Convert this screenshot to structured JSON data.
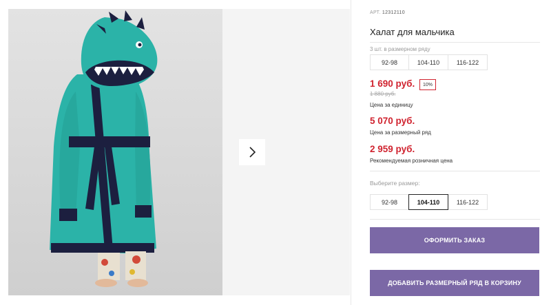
{
  "product": {
    "article_label": "АРТ.",
    "article_value": "12312110",
    "title": "Халат для мальчика",
    "pack_info": "3 шт. в размерном ряду",
    "pack_sizes": [
      "92-98",
      "104-110",
      "116-122"
    ]
  },
  "pricing": {
    "unit_price": "1 690 руб.",
    "discount": "10%",
    "old_price": "1 880 руб.",
    "unit_caption": "Цена за единицу",
    "set_price": "5 070 руб.",
    "set_caption": "Цена за размерный ряд",
    "retail_price": "2 959 руб.",
    "retail_caption": "Рекомендуемая розничная цена"
  },
  "size_selector": {
    "label": "Выберите размер:",
    "options": [
      "92-98",
      "104-110",
      "116-122"
    ],
    "selected": "104-110"
  },
  "actions": {
    "order_label": "ОФОРМИТЬ ЗАКАЗ",
    "add_to_cart_label": "ДОБАВИТЬ РАЗМЕРНЫЙ РЯД В КОРЗИНУ"
  },
  "gallery": {
    "next_icon": "chevron-right-icon"
  },
  "colors": {
    "price_red": "#d0232f",
    "button_purple": "#7b68a6",
    "robe_teal": "#2bb3a8",
    "trim_navy": "#1c1f3f"
  }
}
